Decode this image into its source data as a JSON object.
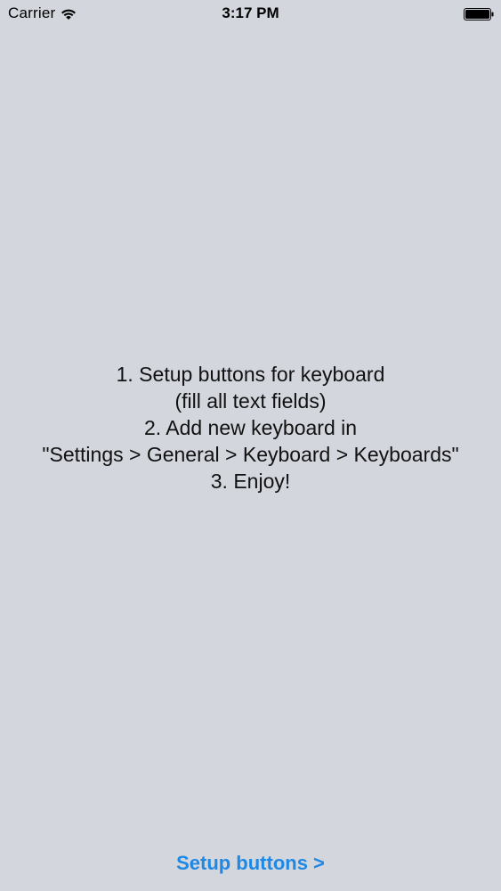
{
  "status_bar": {
    "carrier": "Carrier",
    "time": "3:17 PM",
    "wifi_icon": "wifi-icon",
    "battery_icon": "battery-icon"
  },
  "instructions": {
    "lines": [
      "1. Setup buttons for keyboard",
      "(fill all text fields)",
      "2. Add new keyboard in",
      "\"Settings > General > Keyboard > Keyboards\"",
      "3. Enjoy!"
    ]
  },
  "footer": {
    "setup_button_label": "Setup buttons >"
  },
  "colors": {
    "background": "#d3d6dd",
    "accent": "#1e88e5",
    "text": "#111111"
  }
}
